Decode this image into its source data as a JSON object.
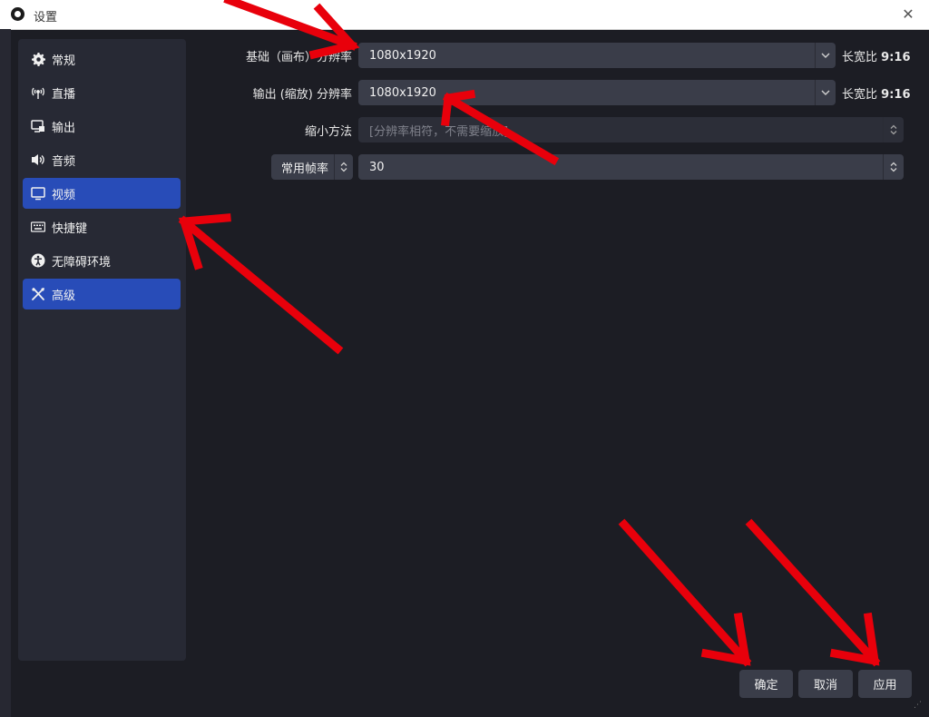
{
  "window": {
    "title": "设置",
    "close_glyph": "✕"
  },
  "sidebar": {
    "items": [
      {
        "label": "常规",
        "icon": "gear-icon",
        "active": false
      },
      {
        "label": "直播",
        "icon": "antenna-icon",
        "active": false
      },
      {
        "label": "输出",
        "icon": "output-icon",
        "active": false
      },
      {
        "label": "音频",
        "icon": "speaker-icon",
        "active": false
      },
      {
        "label": "视频",
        "icon": "monitor-icon",
        "active": true
      },
      {
        "label": "快捷键",
        "icon": "keyboard-icon",
        "active": false
      },
      {
        "label": "无障碍环境",
        "icon": "accessibility-icon",
        "active": false
      },
      {
        "label": "高级",
        "icon": "tools-icon",
        "active": true
      }
    ]
  },
  "video": {
    "base_resolution": {
      "label": "基础（画布）分辨率",
      "value": "1080x1920",
      "aspect_label": "长宽比",
      "aspect_value": "9:16"
    },
    "output_resolution": {
      "label": "输出 (缩放) 分辨率",
      "value": "1080x1920",
      "aspect_label": "长宽比",
      "aspect_value": "9:16"
    },
    "downscale_filter": {
      "label": "缩小方法",
      "value": "[分辨率相符，不需要缩放]"
    },
    "fps": {
      "type_label": "常用帧率",
      "value": "30"
    }
  },
  "buttons": {
    "ok": "确定",
    "cancel": "取消",
    "apply": "应用"
  },
  "colors": {
    "accent": "#284cb8",
    "background": "#1c1d24",
    "sidebar": "#272934",
    "field": "#3a3d49",
    "annotation": "#e8000b"
  }
}
